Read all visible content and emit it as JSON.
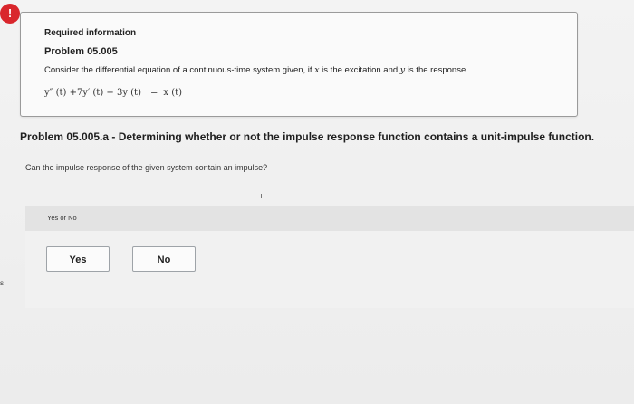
{
  "alert": {
    "glyph": "!"
  },
  "info": {
    "title": "Required information",
    "problem": "Problem 05.005",
    "description_parts": {
      "before_x": "Consider the differential equation of a continuous-time system given, if ",
      "x": "x",
      "between": " is the excitation and ",
      "y": "y",
      "after_y": " is the response."
    },
    "equation": {
      "lhs": "y″ (t) +7y′ (t) + 3y (t)",
      "equals": "=",
      "rhs": "x (t)"
    }
  },
  "part": {
    "heading": "Problem 05.005.a - Determining whether or not the impulse response function contains a unit-impulse function."
  },
  "question": "Can the impulse response of the given system contain an impulse?",
  "answer": {
    "label": "Yes or No",
    "options": [
      "Yes",
      "No"
    ]
  },
  "edge": {
    "mark": "s"
  },
  "colors": {
    "alert": "#d9262c",
    "box_border": "#9a9a9a",
    "answer_bar": "#e3e3e3",
    "button_border": "#9ea3a8"
  }
}
